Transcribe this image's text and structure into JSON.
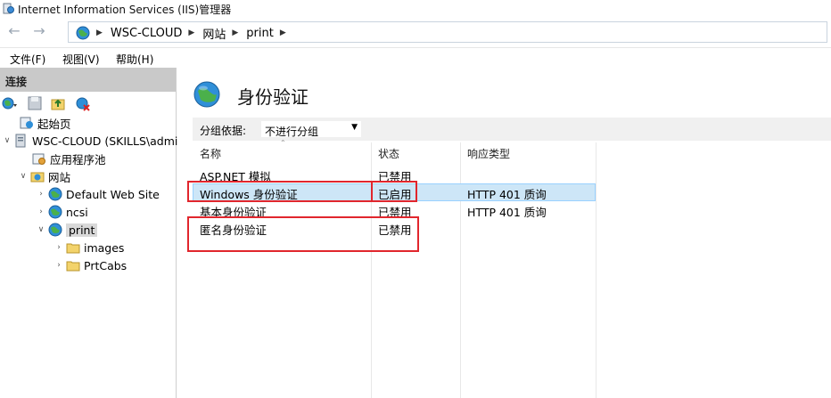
{
  "window": {
    "title": "Internet Information Services (IIS)管理器"
  },
  "address": {
    "back_icon": "back-arrow-icon",
    "forward_icon": "forward-arrow-icon",
    "crumbs": [
      "WSC-CLOUD",
      "网站",
      "print"
    ]
  },
  "menu": {
    "file": "文件(F)",
    "view": "视图(V)",
    "help": "帮助(H)"
  },
  "connections": {
    "header": "连接",
    "tree": {
      "start_page": "起始页",
      "server": "WSC-CLOUD (SKILLS\\admi",
      "app_pools": "应用程序池",
      "sites": "网站",
      "default_site": "Default Web Site",
      "ncsi": "ncsi",
      "print": "print",
      "images": "images",
      "prtcabs": "PrtCabs"
    }
  },
  "main": {
    "title": "身份验证",
    "group_by_label": "分组依据:",
    "group_by_value": "不进行分组",
    "columns": {
      "name": "名称",
      "status": "状态",
      "response_type": "响应类型"
    },
    "rows": [
      {
        "name": "ASP.NET 模拟",
        "status": "已禁用",
        "response": ""
      },
      {
        "name": "Windows 身份验证",
        "status": "已启用",
        "response": "HTTP 401 质询"
      },
      {
        "name": "基本身份验证",
        "status": "已禁用",
        "response": "HTTP 401 质询"
      },
      {
        "name": "匿名身份验证",
        "status": "已禁用",
        "response": ""
      }
    ]
  },
  "colors": {
    "selection": "#cde6f7",
    "highlight_box": "#e1262d",
    "header_gray": "#c9c9c9"
  }
}
